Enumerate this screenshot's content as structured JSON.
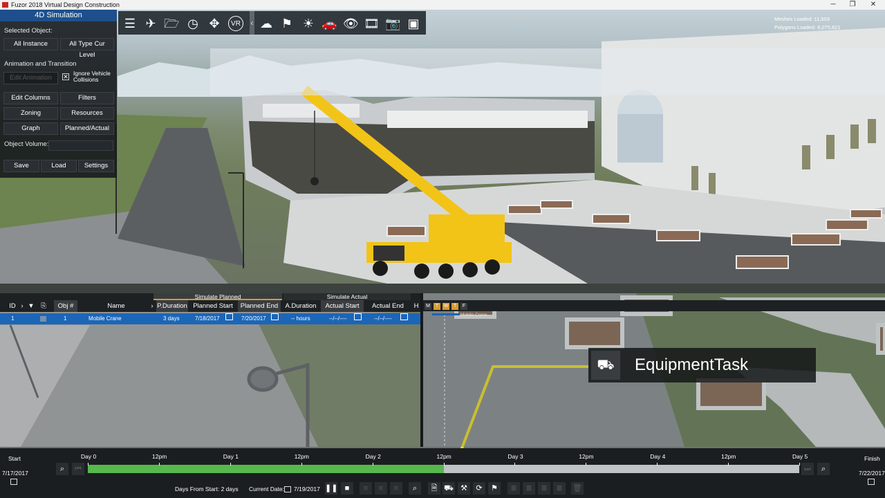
{
  "window": {
    "title": "Fuzor 2018 Virtual Design Construction",
    "minimize": "─",
    "maximize": "❐",
    "close": "✕"
  },
  "left_panel": {
    "title": "4D Simulation",
    "selected_object_label": "Selected Object:",
    "all_instance": "All Instance",
    "all_type_cur_level": "All Type Cur Level",
    "animation_label": "Animation and Transition",
    "edit_animation": "Edit Animation",
    "ignore_vehicle_collisions": "Ignore Vehicle Collisions",
    "ignore_vehicle_checked": true,
    "edit_columns": "Edit Columns",
    "filters": "Filters",
    "zoning": "Zoning",
    "resources": "Resources",
    "graph": "Graph",
    "planned_actual": "Planned/Actual",
    "object_volume_label": "Object Volume:",
    "save": "Save",
    "load": "Load",
    "settings": "Settings"
  },
  "toolbar": {
    "left_icons": [
      "list-icon",
      "drone-icon",
      "folder-icon",
      "clock-icon",
      "move-icon",
      "vr-icon"
    ],
    "right_icons": [
      "cloud-sync-icon",
      "site-analysis-icon",
      "lighting-icon",
      "vehicle-icon",
      "eye-icon",
      "film-icon",
      "camera-icon",
      "presentation-icon"
    ],
    "vr_label": "VR",
    "collapse_glyph": "‹"
  },
  "stats": {
    "meshes_loaded": "Meshes Loaded: 11,503",
    "polygons_loaded": "Polygons Loaded: 8,075,821"
  },
  "task_table": {
    "group_planned": "Simulate Planned",
    "group_actual": "Simulate Actual",
    "columns": [
      "ID",
      "Obj #",
      "Name",
      "P.Duration",
      "Planned Start",
      "Planned End",
      "A.Duration",
      "Actual Start",
      "Actual End",
      "H"
    ],
    "rows": [
      {
        "id": "1",
        "obj": "1",
        "name": "Mobile Crane",
        "p_duration": "3 days",
        "planned_start": "7/18/2017",
        "planned_end": "7/20/2017",
        "a_duration": "-- hours",
        "actual_start": "--/--/----",
        "actual_end": "--/--/----"
      }
    ]
  },
  "gantt": {
    "day_tags": [
      "M",
      "T",
      "W",
      "T",
      "F"
    ],
    "task_label": "Mobile Crane"
  },
  "callout": {
    "icon": "equipment-icon",
    "text": "EquipmentTask"
  },
  "timeline": {
    "start_label": "Start",
    "finish_label": "Finish",
    "start_date": "7/17/2017",
    "finish_date": "7/22/2017",
    "ticks": [
      "Day 0",
      "12pm",
      "Day 1",
      "12pm",
      "Day 2",
      "12pm",
      "Day 3",
      "12pm",
      "Day 4",
      "12pm",
      "Day 5"
    ],
    "progress_fraction": 0.5,
    "days_from_start": "Days From Start:  2 days",
    "current_date_label": "Current Date:",
    "current_date": "7/19/2017"
  },
  "colors": {
    "accent_blue": "#1b66b8",
    "progress_green": "#56b84d",
    "planned_orange": "#d69b2f",
    "callout_line": "#f0e020",
    "crane_yellow": "#f2c418"
  }
}
